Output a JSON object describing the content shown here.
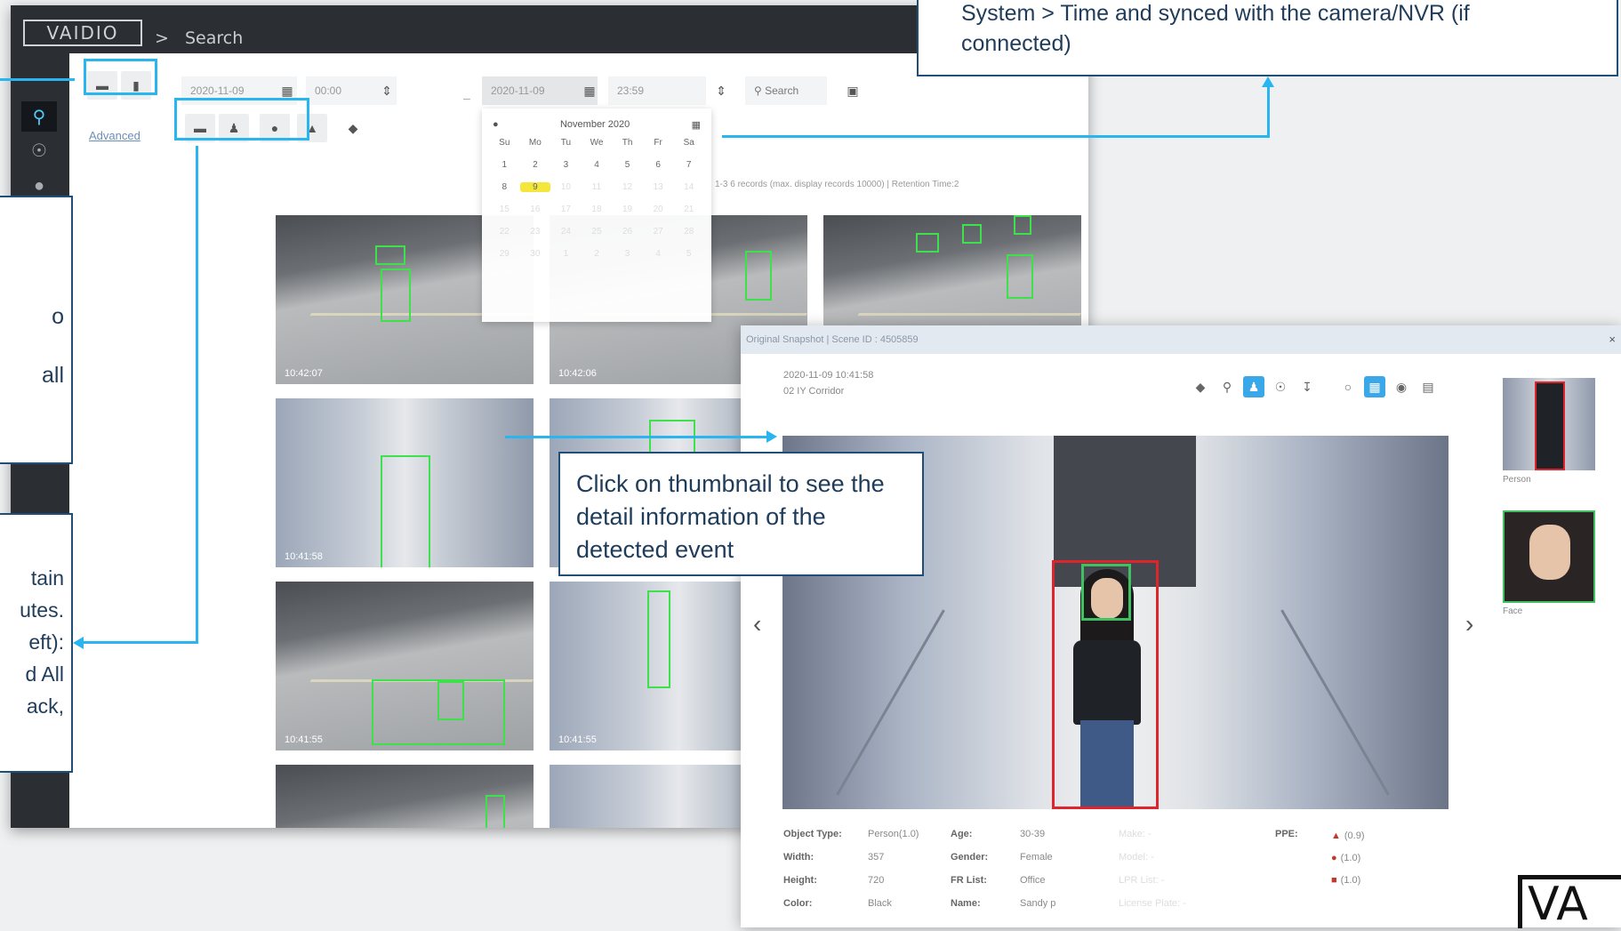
{
  "app": {
    "logo": "VAIDIO",
    "breadcrumb_sep": ">",
    "breadcrumb": "Search"
  },
  "toolbar": {
    "start_date": "2020-11-09",
    "start_time": "00:00",
    "end_date": "2020-11-09",
    "end_time": "23:59",
    "search_label": "Search",
    "advanced_label": "Advanced"
  },
  "calendar": {
    "month_label": "November 2020",
    "weekdays": [
      "Su",
      "Mo",
      "Tu",
      "We",
      "Th",
      "Fr",
      "Sa"
    ]
  },
  "results_info": "1-3 6 records (max. display records 10000) | Retention Time:2",
  "thumbnails": [
    {
      "time": "10:42:07"
    },
    {
      "time": "10:42:06"
    },
    {
      "time": ""
    },
    {
      "time": "10:41:58"
    },
    {
      "time": ""
    },
    {
      "time": "10:41:55"
    },
    {
      "time": "10:41:55"
    },
    {
      "time": ""
    }
  ],
  "callouts": {
    "top": "System > Time and synced with the camera/NVR (if connected)",
    "left1_line1": "o",
    "left1_line2": "all",
    "left2_line1": "tain",
    "left2_line2": "utes.",
    "left2_line3": "eft):",
    "left2_line4": "d All",
    "left2_line5": "ack,",
    "mid": "Click on thumbnail to see the detail information of the detected event"
  },
  "modal": {
    "title": "Original Snapshot | Scene ID : 4505859",
    "close": "×",
    "timestamp": "2020-11-09 10:41:58",
    "location": "02 IY Corridor",
    "attributes": {
      "object_type_label": "Object Type:",
      "object_type": "Person(1.0)",
      "width_label": "Width:",
      "width": "357",
      "height_label": "Height:",
      "height": "720",
      "color_label": "Color:",
      "color": "Black",
      "age_label": "Age:",
      "age": "30-39",
      "gender_label": "Gender:",
      "gender": "Female",
      "fr_list_label": "FR List:",
      "fr_list": "Office",
      "name_label": "Name:",
      "name": "Sandy p",
      "make_label": "Make: -",
      "model_label": "Model: -",
      "lpr_label": "LPR List: -",
      "plate_label": "License Plate: -",
      "ppe_label": "PPE:",
      "ppe_values": [
        "(0.9)",
        "(1.0)",
        "(1.0)"
      ]
    },
    "side": [
      {
        "label": "Person"
      },
      {
        "label": "Face"
      }
    ]
  },
  "colors": {
    "accent": "#29b6f0",
    "callout_border": "#1f4e79",
    "person_box": "#e0242c",
    "face_box": "#40c060"
  }
}
